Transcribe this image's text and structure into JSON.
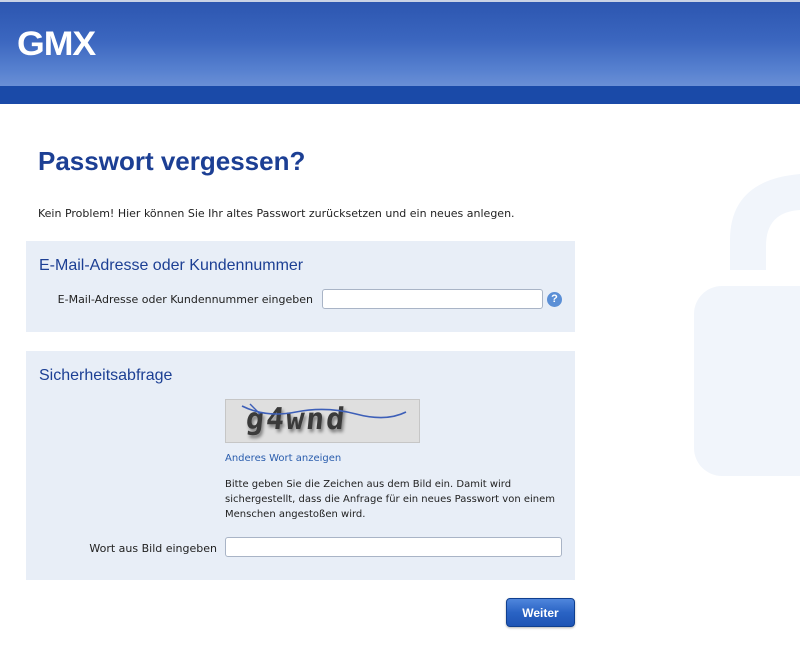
{
  "header": {
    "logo_text": "GMX"
  },
  "page": {
    "title": "Passwort vergessen?",
    "intro": "Kein Problem! Hier können Sie Ihr altes Passwort zurücksetzen und ein neues anlegen."
  },
  "email_section": {
    "heading": "E-Mail-Adresse oder Kundennummer",
    "label": "E-Mail-Adresse oder Kundennummer eingeben",
    "value": "",
    "help_icon": "question-circle-icon",
    "help_glyph": "?"
  },
  "security_section": {
    "heading": "Sicherheitsabfrage",
    "captcha_text": "g4wnd",
    "other_word_link": "Anderes Wort anzeigen",
    "explanation": "Bitte geben Sie die Zeichen aus dem Bild ein. Damit wird sichergestellt, dass die Anfrage für ein neues Passwort von einem Menschen angestoßen wird.",
    "label": "Wort aus Bild eingeben",
    "value": ""
  },
  "actions": {
    "submit_label": "Weiter"
  },
  "colors": {
    "brand_blue": "#1c3f94",
    "header_band": "#1a4aa8",
    "panel_bg": "#e8eef7",
    "link": "#2a5dad"
  }
}
